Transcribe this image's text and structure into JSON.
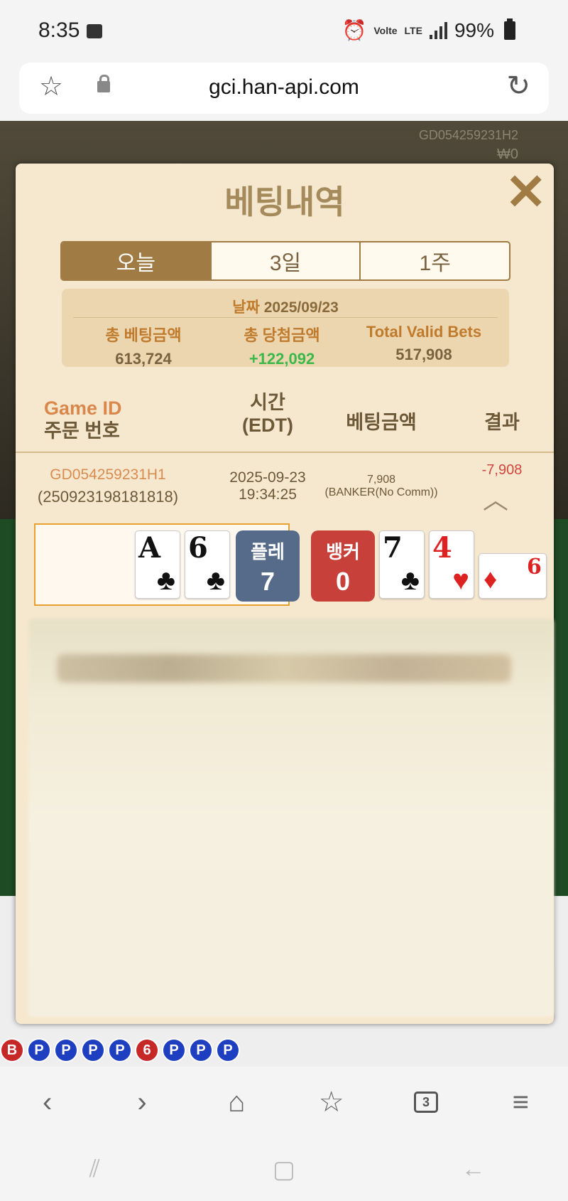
{
  "status": {
    "time": "8:35",
    "lte": "Volte",
    "battery": "99%"
  },
  "browser": {
    "url": "gci.han-api.com",
    "tab_count": "3"
  },
  "background": {
    "game_id": "GD054259231H2",
    "won": "₩0",
    "road": [
      "B",
      "P",
      "P",
      "P",
      "P",
      "6",
      "P",
      "P",
      "P"
    ]
  },
  "modal": {
    "title": "베팅내역",
    "close": "✕",
    "tabs": [
      {
        "label": "오늘",
        "active": true
      },
      {
        "label": "3일",
        "active": false
      },
      {
        "label": "1주",
        "active": false
      }
    ],
    "summary": {
      "date_label": "날짜",
      "date": "2025/09/23",
      "total_bet_label": "총 베팅금액",
      "total_bet": "613,724",
      "total_win_label": "총 당첨금액",
      "total_win": "+122,092",
      "valid_label": "Total Valid Bets",
      "valid": "517,908"
    },
    "table": {
      "headers": {
        "game_id": "Game ID",
        "order": "주문 번호",
        "time": "시간",
        "time_tz": "(EDT)",
        "bet": "베팅금액",
        "result": "결과"
      },
      "rows": [
        {
          "game_id": "GD054259231H1",
          "order": "(250923198181818)",
          "date": "2025-09-23",
          "time": "19:34:25",
          "bet_amount": "7,908",
          "bet_type": "(BANKER(No Comm))",
          "result": "-7,908"
        }
      ]
    },
    "cards": {
      "player": [
        {
          "rank": "A",
          "suit": "♣",
          "color": "black"
        },
        {
          "rank": "6",
          "suit": "♣",
          "color": "black"
        }
      ],
      "player_label": "플레",
      "player_score": "7",
      "banker_label": "뱅커",
      "banker_score": "0",
      "banker": [
        {
          "rank": "7",
          "suit": "♣",
          "color": "black"
        },
        {
          "rank": "4",
          "suit": "♥",
          "color": "red"
        },
        {
          "rank": "9",
          "suit": "♦",
          "color": "red",
          "sideways": true
        }
      ]
    }
  }
}
